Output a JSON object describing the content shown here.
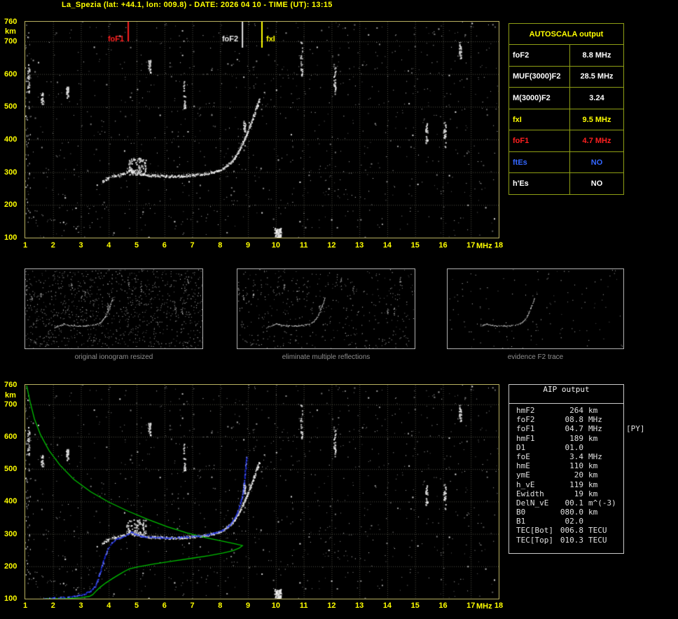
{
  "title": "La_Spezia (lat: +44.1, lon: 009.8) - DATE: 2026 04 10 - TIME (UT): 13:15",
  "colors": {
    "background": "#000000",
    "title_yellow": "#ffff00",
    "axis_tick": "#ffff00",
    "plot_border": "#b8b060",
    "grid": "#4f4f45",
    "echo_white": "#ffffff",
    "profile_green": "#00c000",
    "scaled_trace_blue": "#2a3cff",
    "foF1_red": "#ff2020",
    "foF2_white": "#e8e8e8",
    "fxI_yellow": "#ffff00",
    "autoscala_border": "#8e9e14",
    "aip_border": "#c8c8c8",
    "caption_gray": "#8f8f8f"
  },
  "autoscala": {
    "title": "AUTOSCALA output",
    "rows": [
      {
        "label": "foF2",
        "value": "8.8 MHz",
        "color": "#ffffff"
      },
      {
        "label": "MUF(3000)F2",
        "value": "28.5 MHz",
        "color": "#ffffff"
      },
      {
        "label": "M(3000)F2",
        "value": "3.24",
        "color": "#ffffff"
      },
      {
        "label": "fxI",
        "value": "9.5 MHz",
        "color": "#ffff00"
      },
      {
        "label": "foF1",
        "value": "4.7 MHz",
        "color": "#ff2020"
      },
      {
        "label": "ftEs",
        "value": "NO",
        "color": "#3366ff"
      },
      {
        "label": "h'Es",
        "value": "NO",
        "color": "#ffffff"
      }
    ]
  },
  "aip": {
    "title": "AIP output",
    "rows": [
      {
        "label": "hmF2",
        "value": "264",
        "unit": "km",
        "note": ""
      },
      {
        "label": "foF2",
        "value": "08.8",
        "unit": "MHz",
        "note": ""
      },
      {
        "label": "foF1",
        "value": "04.7",
        "unit": "MHz",
        "note": "[PY]"
      },
      {
        "label": "hmF1",
        "value": "189",
        "unit": "km",
        "note": ""
      },
      {
        "label": "D1",
        "value": "01.0",
        "unit": "",
        "note": ""
      },
      {
        "label": "foE",
        "value": "3.4",
        "unit": "MHz",
        "note": ""
      },
      {
        "label": "hmE",
        "value": "110",
        "unit": "km",
        "note": ""
      },
      {
        "label": "ymE",
        "value": "20",
        "unit": "km",
        "note": ""
      },
      {
        "label": "h_vE",
        "value": "119",
        "unit": "km",
        "note": ""
      },
      {
        "label": "Ewidth",
        "value": "19",
        "unit": "km",
        "note": ""
      },
      {
        "label": "DelN_vE",
        "value": "00.1",
        "unit": "m^(-3)",
        "note": ""
      },
      {
        "label": "B0",
        "value": "080.0",
        "unit": "km",
        "note": ""
      },
      {
        "label": "B1",
        "value": "02.0",
        "unit": "",
        "note": ""
      },
      {
        "label": "TEC[Bot]",
        "value": "006.8",
        "unit": "TECU",
        "note": ""
      },
      {
        "label": "TEC[Top]",
        "value": "010.3",
        "unit": "TECU",
        "note": ""
      }
    ]
  },
  "thumbnails": [
    {
      "caption": "original ionogram resized",
      "noise": 1000
    },
    {
      "caption": "eliminate multiple reflections",
      "noise": 430
    },
    {
      "caption": "evidence F2 trace",
      "noise": 130
    }
  ],
  "chart_data": [
    {
      "type": "scatter",
      "title": "ionogram echo trace with AUTOSCALA critical frequency markers",
      "xlabel": "MHz",
      "ylabel": "km",
      "xlim": [
        1,
        18
      ],
      "ylim": [
        100,
        760
      ],
      "grid": true,
      "x_ticks": [
        1,
        2,
        3,
        4,
        5,
        6,
        7,
        8,
        9,
        10,
        11,
        12,
        13,
        14,
        15,
        16,
        17,
        18
      ],
      "y_ticks": [
        760,
        700,
        600,
        500,
        400,
        300,
        200,
        100
      ],
      "markers": [
        {
          "label": "foF1",
          "mhz": 4.7,
          "color": "#ff2020",
          "line_len": 28,
          "side": "left"
        },
        {
          "label": "foF2",
          "mhz": 8.8,
          "color": "#e8e8e8",
          "line_len": 37,
          "side": "left"
        },
        {
          "label": "fxI",
          "mhz": 9.5,
          "color": "#ffff00",
          "line_len": 37,
          "side": "right"
        }
      ],
      "trace_virtual_height": [
        [
          3.75,
          272
        ],
        [
          3.9,
          280
        ],
        [
          4.05,
          287
        ],
        [
          4.2,
          291
        ],
        [
          4.4,
          294
        ],
        [
          4.6,
          299
        ],
        [
          4.75,
          307
        ],
        [
          4.9,
          302
        ],
        [
          5.1,
          296
        ],
        [
          5.4,
          292
        ],
        [
          5.8,
          290
        ],
        [
          6.2,
          289
        ],
        [
          6.6,
          290
        ],
        [
          7.0,
          292
        ],
        [
          7.3,
          295
        ],
        [
          7.6,
          299
        ],
        [
          7.9,
          305
        ],
        [
          8.1,
          313
        ],
        [
          8.3,
          325
        ],
        [
          8.45,
          339
        ],
        [
          8.6,
          357
        ],
        [
          8.75,
          381
        ],
        [
          8.9,
          410
        ],
        [
          9.05,
          441
        ],
        [
          9.18,
          471
        ],
        [
          9.3,
          500
        ],
        [
          9.4,
          524
        ]
      ],
      "e_trace": [
        [
          1.3,
          185
        ],
        [
          1.6,
          170
        ],
        [
          1.9,
          158
        ],
        [
          2.2,
          148
        ],
        [
          2.5,
          140
        ],
        [
          2.8,
          135
        ],
        [
          3.05,
          132
        ],
        [
          3.25,
          137
        ],
        [
          3.4,
          147
        ]
      ],
      "cusp_cluster": {
        "mhz": [
          4.62,
          5.32
        ],
        "km": [
          293,
          345
        ]
      },
      "streaks": [
        [
          1.1,
          545,
          635
        ],
        [
          1.6,
          505,
          545
        ],
        [
          2.5,
          528,
          562
        ],
        [
          5.45,
          600,
          645
        ],
        [
          6.7,
          495,
          580
        ],
        [
          8.86,
          425,
          458
        ],
        [
          10.9,
          590,
          700
        ],
        [
          12.1,
          538,
          623
        ],
        [
          15.4,
          390,
          450
        ],
        [
          16.05,
          378,
          458
        ],
        [
          16.6,
          645,
          698
        ]
      ],
      "blob": [
        10.05,
        100,
        130
      ],
      "noise_seed": 20260410,
      "noise_points": 1000
    },
    {
      "type": "scatter",
      "title": "ionogram with AIP inverted electron density profile and scaled trace",
      "xlabel": "MHz",
      "ylabel": "km",
      "xlim": [
        1,
        18
      ],
      "ylim": [
        100,
        760
      ],
      "grid": true,
      "x_ticks": [
        1,
        2,
        3,
        4,
        5,
        6,
        7,
        8,
        9,
        10,
        11,
        12,
        13,
        14,
        15,
        16,
        17,
        18
      ],
      "y_ticks": [
        760,
        700,
        600,
        500,
        400,
        300,
        200,
        100
      ],
      "profile_electron_density": [
        [
          1.05,
          758
        ],
        [
          1.18,
          706
        ],
        [
          1.33,
          655
        ],
        [
          1.55,
          606
        ],
        [
          1.85,
          558
        ],
        [
          2.25,
          512
        ],
        [
          2.75,
          468
        ],
        [
          3.35,
          430
        ],
        [
          4.0,
          398
        ],
        [
          4.7,
          370
        ],
        [
          5.4,
          345
        ],
        [
          6.1,
          322
        ],
        [
          6.8,
          303
        ],
        [
          7.5,
          288
        ],
        [
          8.1,
          277
        ],
        [
          8.55,
          269
        ],
        [
          8.8,
          264
        ],
        [
          8.68,
          256
        ],
        [
          8.45,
          248
        ],
        [
          8.1,
          241
        ],
        [
          7.6,
          233
        ],
        [
          7.0,
          225
        ],
        [
          6.3,
          216
        ],
        [
          5.6,
          207
        ],
        [
          5.05,
          198
        ],
        [
          4.75,
          192
        ],
        [
          4.6,
          186
        ],
        [
          4.4,
          176
        ],
        [
          4.15,
          163
        ],
        [
          3.9,
          149
        ],
        [
          3.7,
          136
        ],
        [
          3.55,
          124
        ],
        [
          3.42,
          112
        ],
        [
          3.3,
          107
        ],
        [
          3.0,
          103
        ],
        [
          2.6,
          101
        ],
        [
          2.1,
          100
        ],
        [
          1.7,
          100
        ]
      ],
      "scaled_trace": [
        [
          1.55,
          100
        ],
        [
          1.75,
          101
        ],
        [
          2.0,
          103
        ],
        [
          2.3,
          105
        ],
        [
          2.6,
          107
        ],
        [
          2.9,
          111
        ],
        [
          3.15,
          117
        ],
        [
          3.35,
          126
        ],
        [
          3.5,
          140
        ],
        [
          3.58,
          158
        ],
        [
          3.66,
          180
        ],
        [
          3.76,
          207
        ],
        [
          3.86,
          235
        ],
        [
          3.96,
          258
        ],
        [
          4.1,
          275
        ],
        [
          4.3,
          287
        ],
        [
          4.5,
          293
        ],
        [
          4.68,
          300
        ],
        [
          4.8,
          307
        ],
        [
          4.95,
          300
        ],
        [
          5.2,
          294
        ],
        [
          5.6,
          291
        ],
        [
          6.0,
          290
        ],
        [
          6.4,
          290
        ],
        [
          6.8,
          292
        ],
        [
          7.2,
          295
        ],
        [
          7.5,
          298
        ],
        [
          7.8,
          304
        ],
        [
          8.05,
          312
        ],
        [
          8.25,
          323
        ],
        [
          8.4,
          337
        ],
        [
          8.55,
          357
        ],
        [
          8.68,
          385
        ],
        [
          8.78,
          420
        ],
        [
          8.85,
          460
        ],
        [
          8.9,
          505
        ],
        [
          8.93,
          540
        ]
      ],
      "noise_seed": 20260410,
      "noise_points": 1000
    }
  ]
}
